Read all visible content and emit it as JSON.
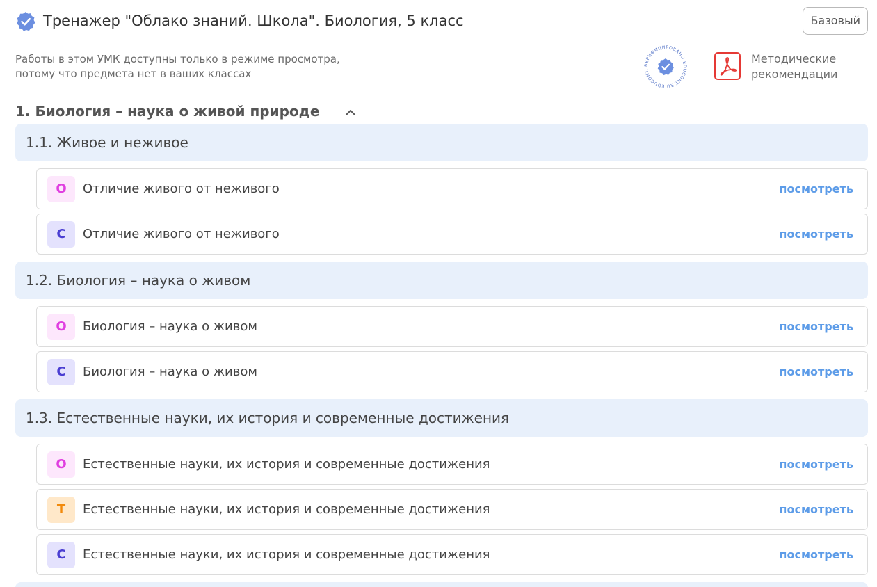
{
  "header": {
    "title": "Тренажер \"Облако знаний. Школа\". Биология, 5 класс",
    "tier_button": "Базовый"
  },
  "notice": {
    "line1": "Работы в этом УМК доступны только в режиме просмотра,",
    "line2": "потому что предмета нет в ваших классах"
  },
  "stamp": {
    "text": "ВЕРИФИЦИРОВАНО EDUCONT.RU EDUCONT.RU"
  },
  "guidelines": {
    "line1": "Методические",
    "line2": "рекомендации"
  },
  "section": {
    "title": "1. Биология – наука о живой природе"
  },
  "topics": [
    {
      "title": "1.1. Живое и неживое",
      "tasks": [
        {
          "badge": "О",
          "kind": "o",
          "label": "Отличие живого от неживого",
          "action": "посмотреть"
        },
        {
          "badge": "С",
          "kind": "c",
          "label": "Отличие живого от неживого",
          "action": "посмотреть"
        }
      ]
    },
    {
      "title": "1.2. Биология – наука о живом",
      "tasks": [
        {
          "badge": "О",
          "kind": "o",
          "label": "Биология – наука о живом",
          "action": "посмотреть"
        },
        {
          "badge": "С",
          "kind": "c",
          "label": "Биология – наука о живом",
          "action": "посмотреть"
        }
      ]
    },
    {
      "title": "1.3. Естественные науки, их история и современные достижения",
      "tasks": [
        {
          "badge": "О",
          "kind": "o",
          "label": "Естественные науки, их история и современные достижения",
          "action": "посмотреть"
        },
        {
          "badge": "Т",
          "kind": "t",
          "label": "Естественные науки, их история и современные достижения",
          "action": "посмотреть"
        },
        {
          "badge": "С",
          "kind": "c",
          "label": "Естественные науки, их история и современные достижения",
          "action": "посмотреть"
        }
      ]
    }
  ],
  "colors": {
    "accent_link": "#5d9ce8",
    "topic_bg": "#e8f0fb",
    "verified_badge": "#6c8fe0",
    "pdf_red": "#e53935"
  },
  "icons": {
    "verified": "verified-badge-icon",
    "pdf": "pdf-icon",
    "collapse": "chevron-up-icon"
  }
}
